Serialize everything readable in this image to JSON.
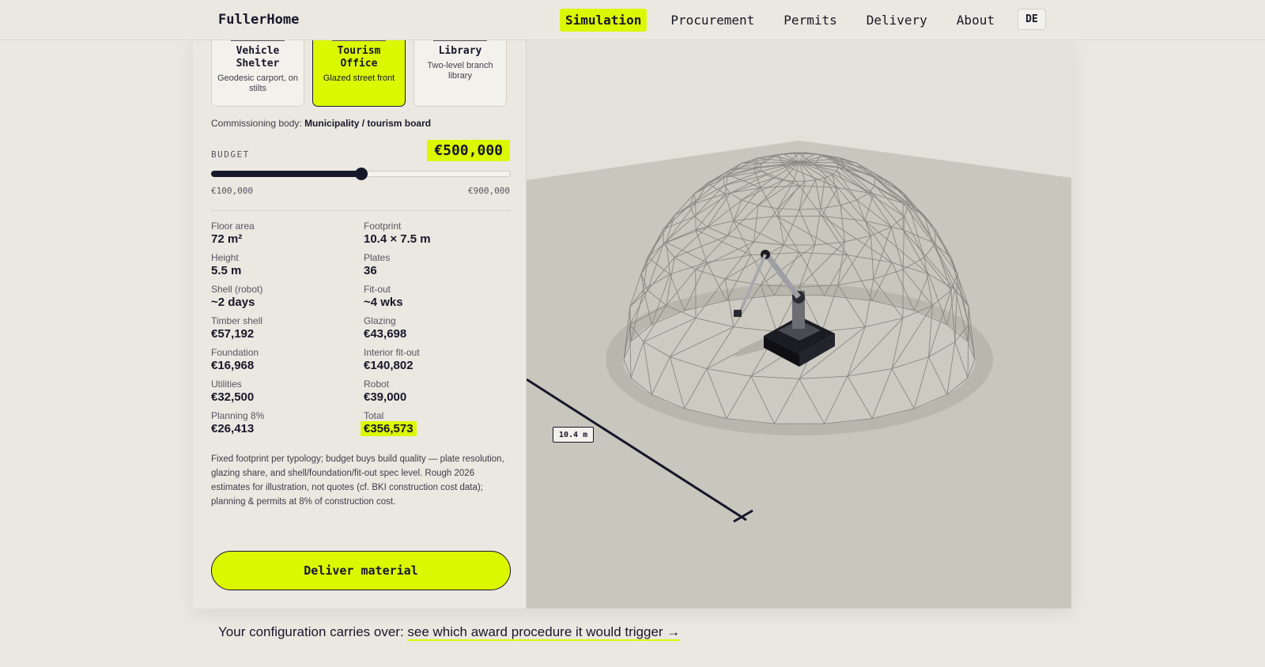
{
  "nav": {
    "brand": "FullerHome",
    "links": [
      {
        "label": "Simulation",
        "active": true
      },
      {
        "label": "Procurement",
        "active": false
      },
      {
        "label": "Permits",
        "active": false
      },
      {
        "label": "Delivery",
        "active": false
      },
      {
        "label": "About",
        "active": false
      }
    ],
    "lang": "DE"
  },
  "types": [
    {
      "name": "Vehicle\nShelter",
      "desc": "Geodesic carport, on stilts",
      "selected": false
    },
    {
      "name": "Tourism\nOffice",
      "desc": "Glazed street front",
      "selected": true
    },
    {
      "name": "Library",
      "desc": "Two-level branch library",
      "selected": false
    }
  ],
  "commission": {
    "label": "Commissioning body:",
    "value": "Municipality / tourism board"
  },
  "budget": {
    "label": "BUDGET",
    "value": "€500,000",
    "min_label": "€100,000",
    "max_label": "€900,000",
    "level": 0.5
  },
  "stats": [
    {
      "label": "Floor area",
      "value": "72 m²"
    },
    {
      "label": "Footprint",
      "value": "10.4 × 7.5 m"
    },
    {
      "label": "Height",
      "value": "5.5 m"
    },
    {
      "label": "Plates",
      "value": "36"
    },
    {
      "label": "Shell (robot)",
      "value": "~2 days"
    },
    {
      "label": "Fit-out",
      "value": "~4 wks"
    },
    {
      "label": "Timber shell",
      "value": "€57,192"
    },
    {
      "label": "Glazing",
      "value": "€43,698"
    },
    {
      "label": "Foundation",
      "value": "€16,968"
    },
    {
      "label": "Interior fit-out",
      "value": "€140,802"
    },
    {
      "label": "Utilities",
      "value": "€32,500"
    },
    {
      "label": "Robot",
      "value": "€39,000"
    },
    {
      "label": "Planning 8%",
      "value": "€26,413"
    },
    {
      "label": "Total",
      "value": "€356,573",
      "highlight": true
    }
  ],
  "note": "Fixed footprint per typology; budget buys build quality — plate resolution, glazing share, and shell/foundation/fit-out spec level. Rough 2026 estimates for illustration, not quotes (cf. BKI construction cost data); planning & permits at 8% of construction cost.",
  "cta": "Deliver material",
  "viewport": {
    "dimension_label": "10.4 m"
  },
  "footer": {
    "text": "Your configuration carries over: ",
    "link": "see which award procedure it would trigger →"
  },
  "colors": {
    "accent": "#dcf800",
    "ink": "#17172a",
    "background": "#ebe8e1",
    "viewport_floor": "#c9c6bd"
  },
  "icons": [
    "vehicle-shelter-icon",
    "tourism-office-icon",
    "library-icon"
  ]
}
